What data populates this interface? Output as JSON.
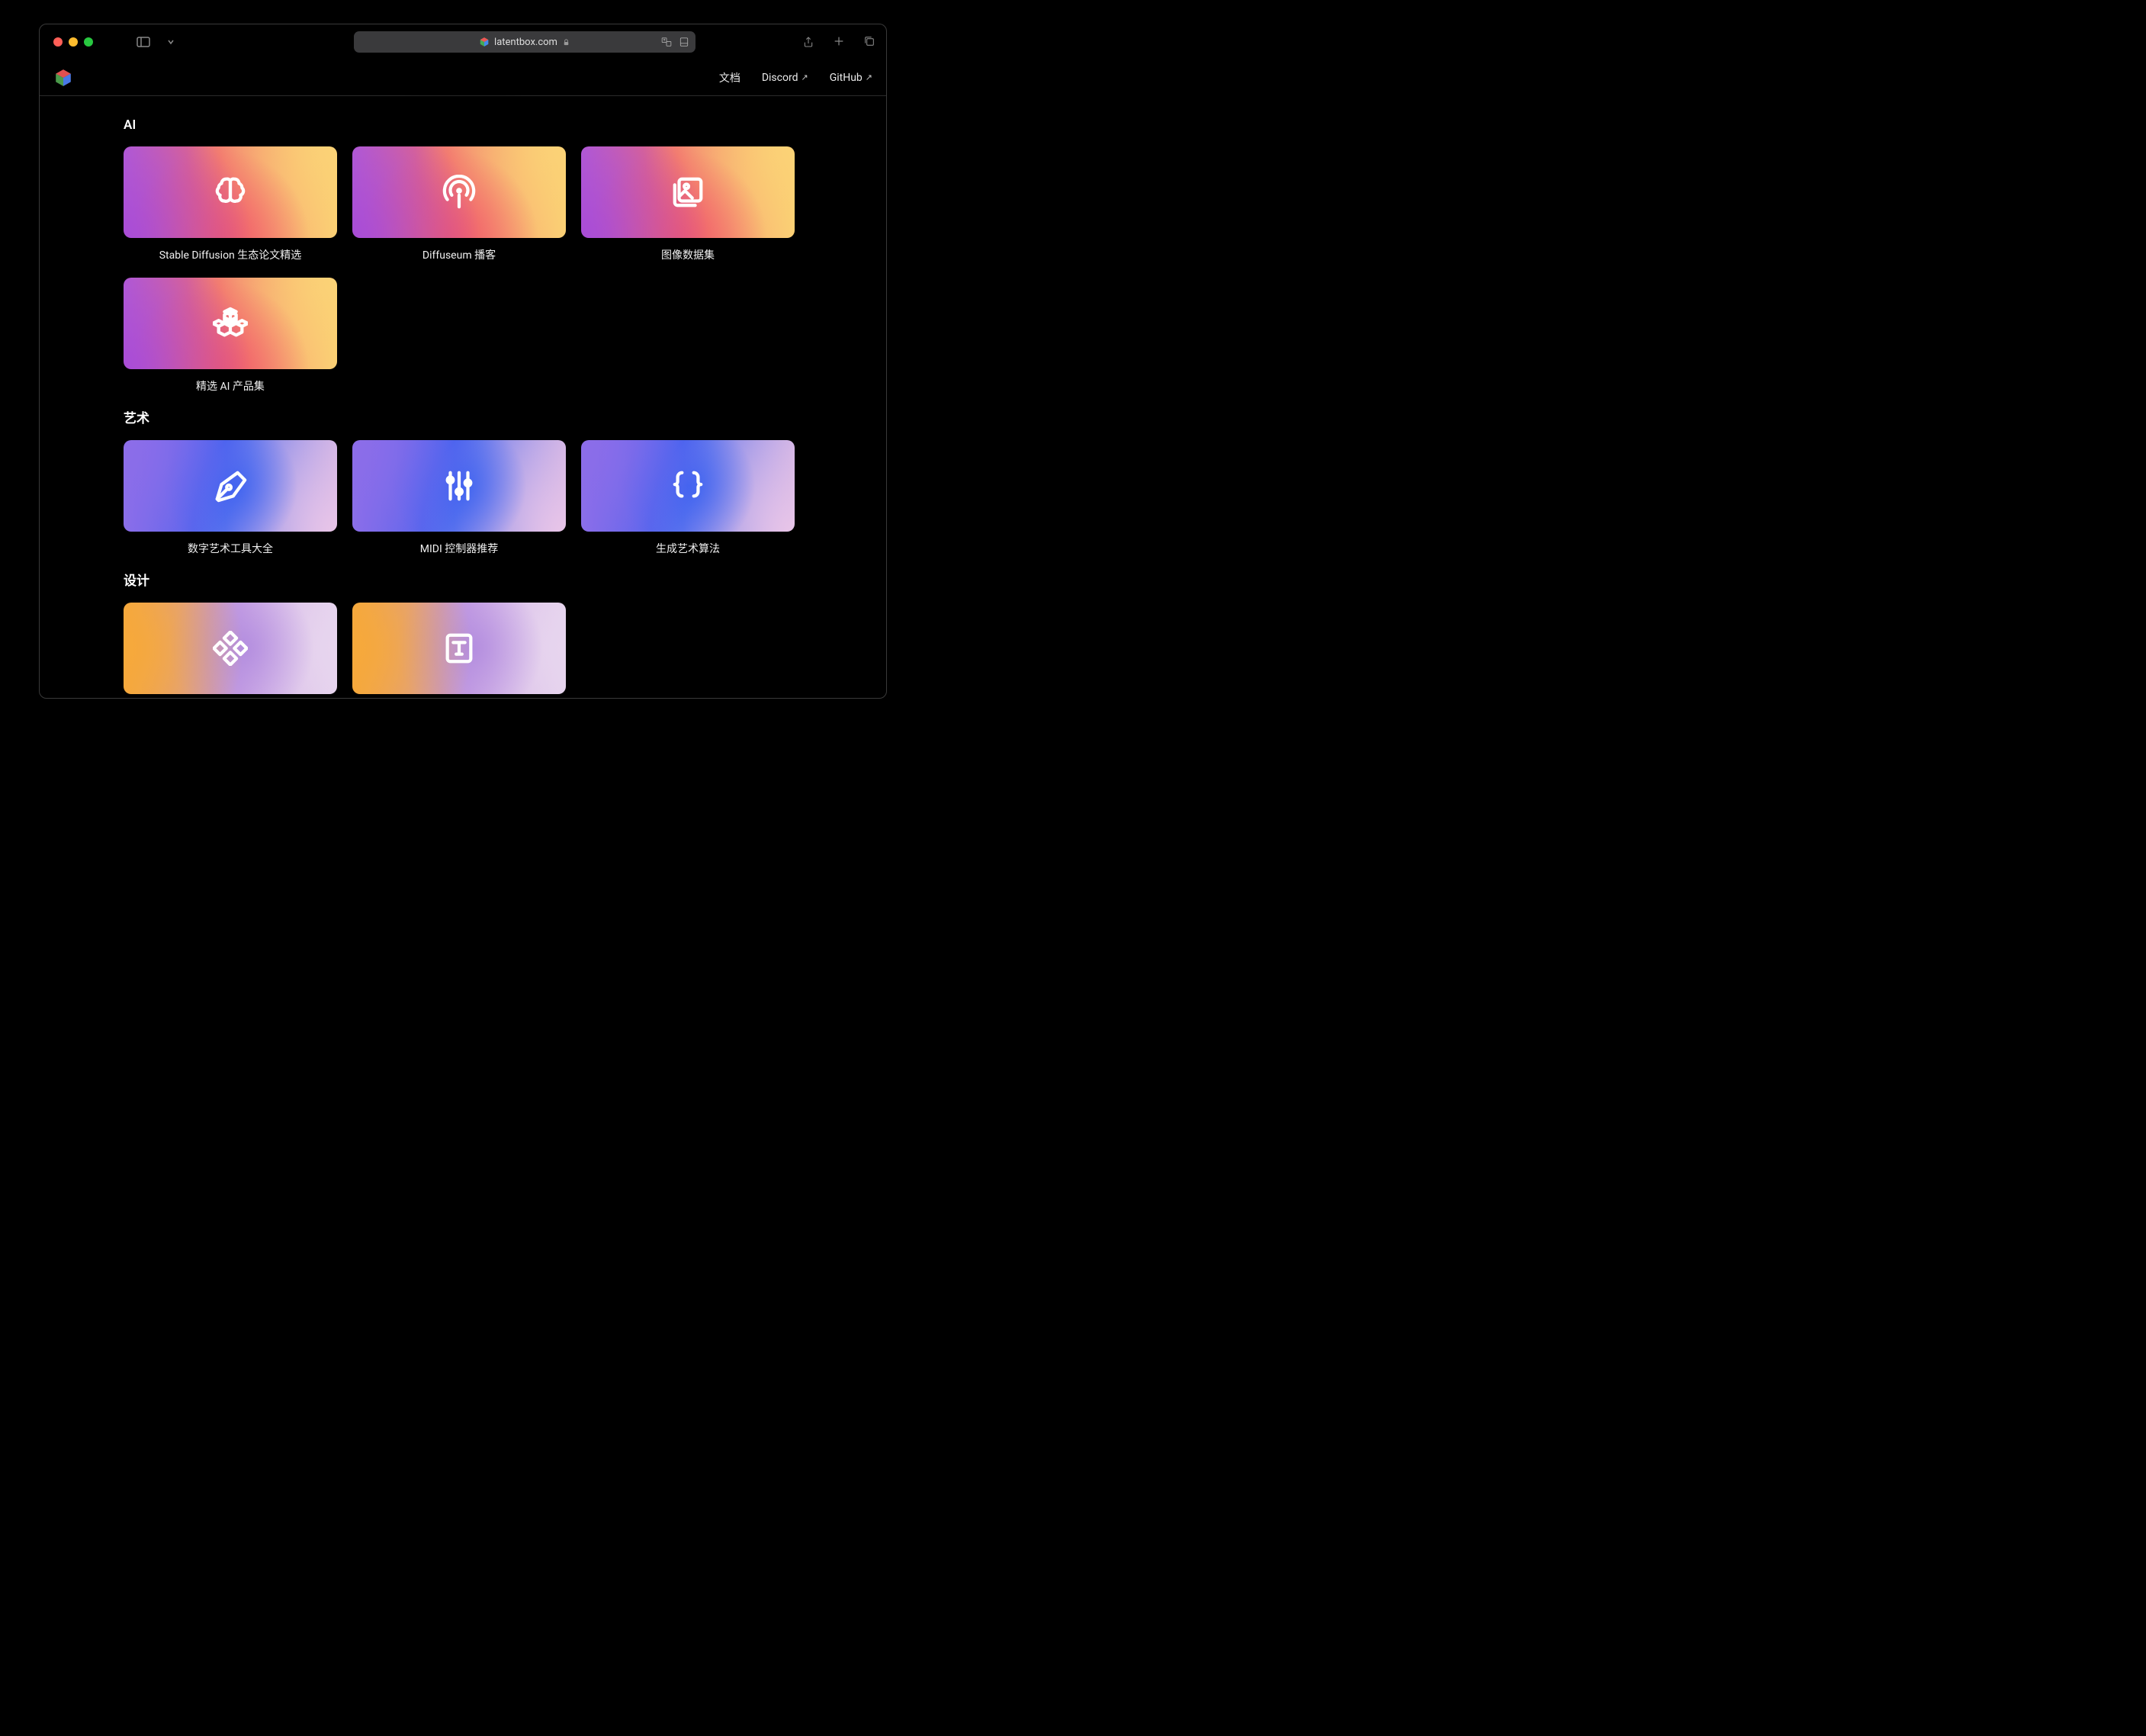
{
  "browser": {
    "url_display": "latentbox.com"
  },
  "nav": {
    "docs": "文档",
    "discord": "Discord",
    "github": "GitHub"
  },
  "sections": {
    "ai": {
      "title": "AI",
      "cards": [
        {
          "label": "Stable Diffusion 生态论文精选",
          "icon": "brain-icon"
        },
        {
          "label": "Diffuseum 播客",
          "icon": "podcast-icon"
        },
        {
          "label": "图像数据集",
          "icon": "images-icon"
        },
        {
          "label": "精选 AI 产品集",
          "icon": "boxes-icon"
        }
      ]
    },
    "art": {
      "title": "艺术",
      "cards": [
        {
          "label": "数字艺术工具大全",
          "icon": "pen-icon"
        },
        {
          "label": "MIDI 控制器推荐",
          "icon": "sliders-icon"
        },
        {
          "label": "生成艺术算法",
          "icon": "braces-icon"
        }
      ]
    },
    "design": {
      "title": "设计",
      "cards": [
        {
          "label": "",
          "icon": "components-icon"
        },
        {
          "label": "",
          "icon": "type-icon"
        }
      ]
    }
  }
}
